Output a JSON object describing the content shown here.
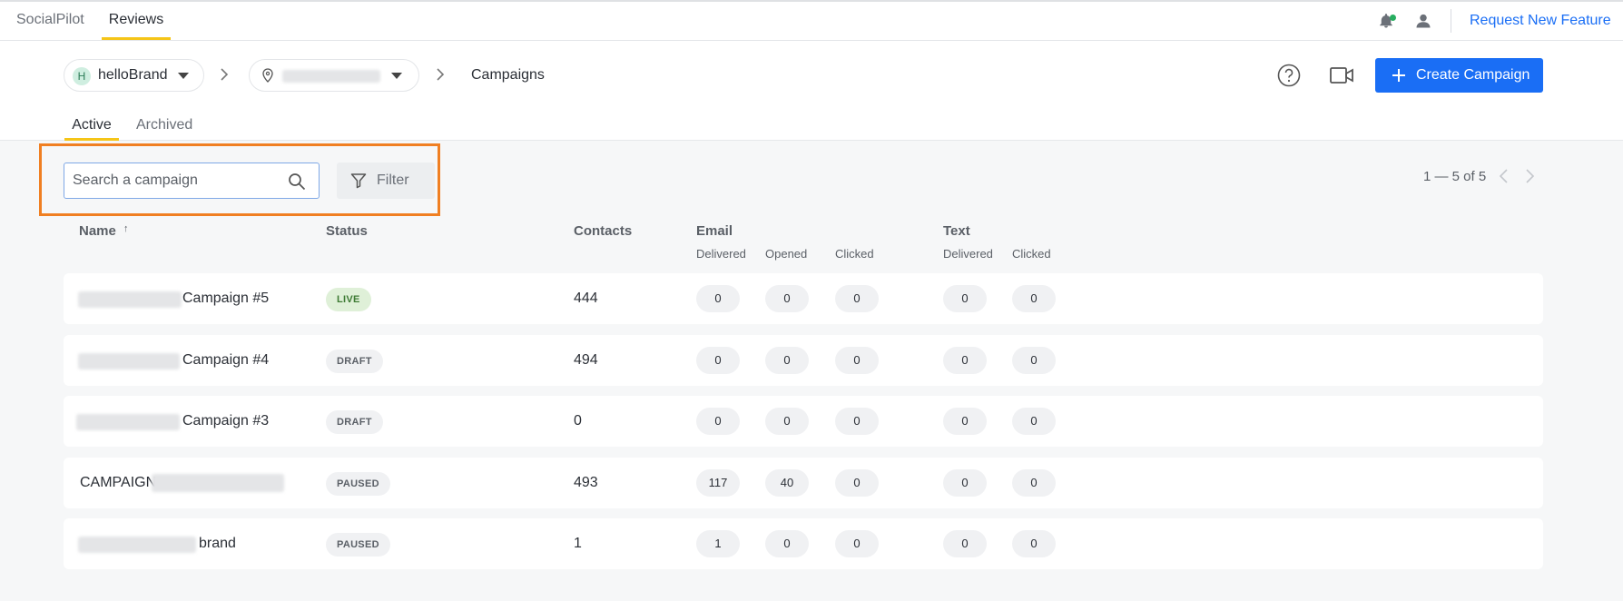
{
  "app": {
    "tabs": [
      "SocialPilot",
      "Reviews"
    ],
    "request_feature": "Request New Feature"
  },
  "breadcrumb": {
    "brand_initial": "H",
    "brand": "helloBrand",
    "current": "Campaigns"
  },
  "actions": {
    "create_label": "Create Campaign"
  },
  "subtabs": [
    "Active",
    "Archived"
  ],
  "search": {
    "placeholder": "Search a campaign"
  },
  "filter_label": "Filter",
  "pager": {
    "text": "1 — 5 of 5"
  },
  "columns": {
    "name": "Name",
    "sort_indicator": "↑",
    "status": "Status",
    "contacts": "Contacts",
    "email": "Email",
    "text": "Text",
    "email_sub": [
      "Delivered",
      "Opened",
      "Clicked"
    ],
    "text_sub": [
      "Delivered",
      "Clicked"
    ]
  },
  "rows": [
    {
      "name": "Campaign #5",
      "status": "LIVE",
      "contacts": "444",
      "email_delivered": "0",
      "email_opened": "0",
      "email_clicked": "0",
      "text_delivered": "0",
      "text_clicked": "0"
    },
    {
      "name": "Campaign #4",
      "status": "DRAFT",
      "contacts": "494",
      "email_delivered": "0",
      "email_opened": "0",
      "email_clicked": "0",
      "text_delivered": "0",
      "text_clicked": "0"
    },
    {
      "name": "Campaign #3",
      "status": "DRAFT",
      "contacts": "0",
      "email_delivered": "0",
      "email_opened": "0",
      "email_clicked": "0",
      "text_delivered": "0",
      "text_clicked": "0"
    },
    {
      "name": "CAMPAIGN",
      "status": "PAUSED",
      "contacts": "493",
      "email_delivered": "117",
      "email_opened": "40",
      "email_clicked": "0",
      "text_delivered": "0",
      "text_clicked": "0"
    },
    {
      "name": "brand",
      "status": "PAUSED",
      "contacts": "1",
      "email_delivered": "1",
      "email_opened": "0",
      "email_clicked": "0",
      "text_delivered": "0",
      "text_clicked": "0"
    }
  ],
  "colors": {
    "accent": "#1a6ef5",
    "tab_underline": "#f5c518",
    "highlight": "#f07f22",
    "live_bg": "#dff0d8"
  }
}
